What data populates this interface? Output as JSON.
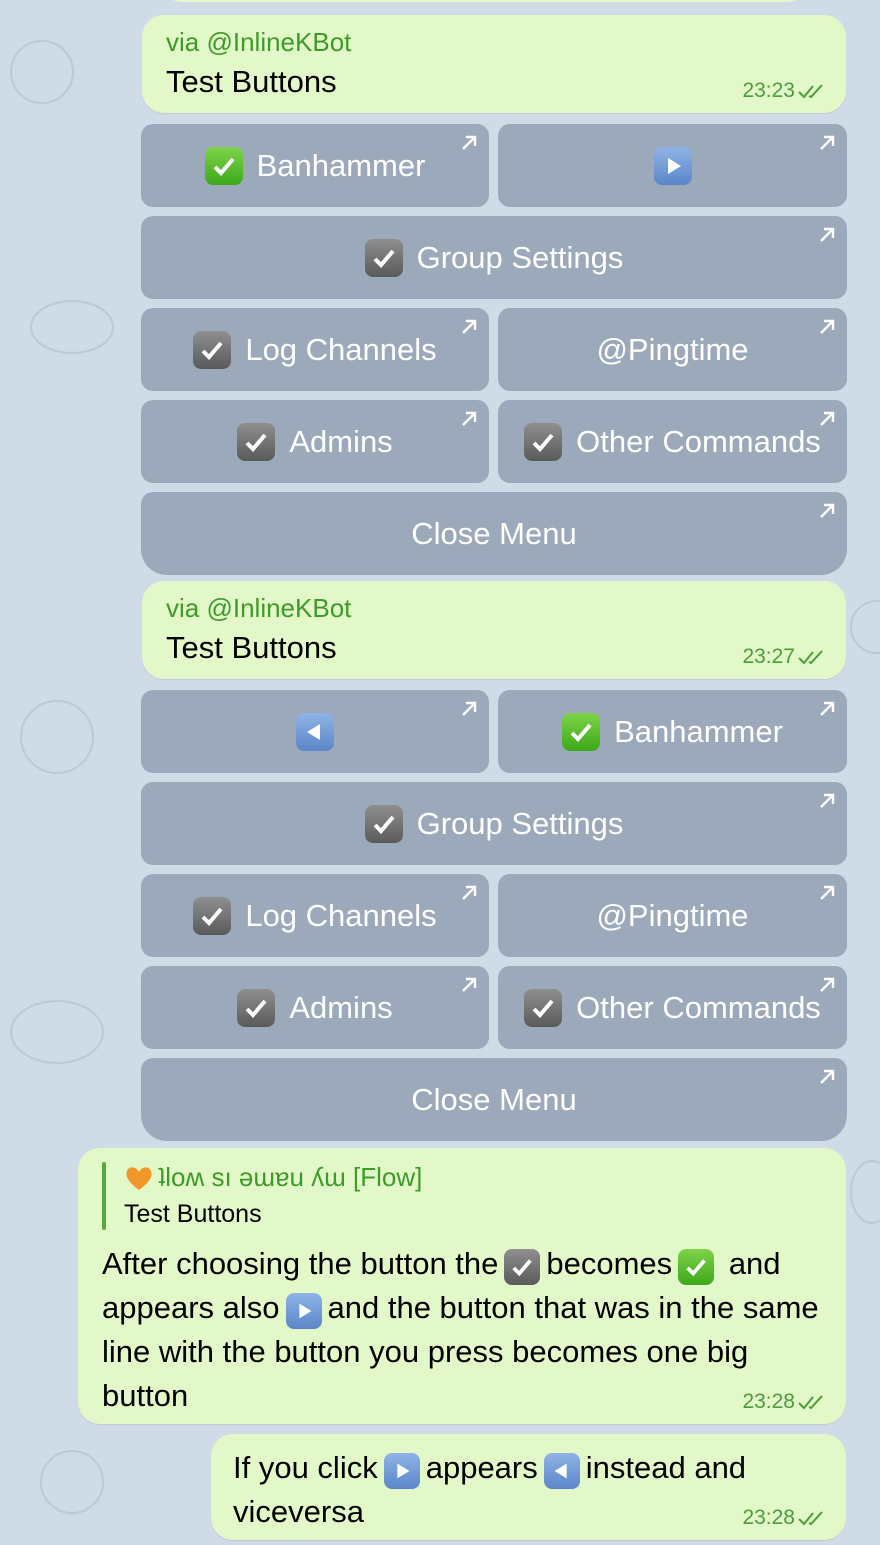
{
  "messages": [
    {
      "via": "via @InlineKBot",
      "title": "Test Buttons",
      "time": "23:23",
      "keyboard": {
        "banhammer": "Banhammer",
        "group_settings": "Group Settings",
        "log_channels": "Log Channels",
        "pingtime": "@Pingtime",
        "admins": "Admins",
        "other_commands": "Other Commands",
        "close_menu": "Close Menu"
      }
    },
    {
      "via": "via @InlineKBot",
      "title": "Test Buttons",
      "time": "23:27",
      "keyboard": {
        "banhammer": "Banhammer",
        "group_settings": "Group Settings",
        "log_channels": "Log Channels",
        "pingtime": "@Pingtime",
        "admins": "Admins",
        "other_commands": "Other Commands",
        "close_menu": "Close Menu"
      }
    }
  ],
  "reply_message": {
    "reply_author": "ʇloʍ sı ǝɯɐu ʎɯ [Flow]",
    "reply_text": "Test Buttons",
    "text_part1": "After choosing the button the",
    "text_part2": "becomes",
    "text_part3": "and appears also",
    "text_part4": "and the button that was in the same line with the button you press becomes one big button",
    "time": "23:28"
  },
  "last_message": {
    "text_part1": "If you click",
    "text_part2": "appears",
    "text_part3": "instead and viceversa",
    "time": "23:28"
  },
  "icons": {
    "check_gray": "ballot-box-with-check-icon",
    "check_green": "white-check-mark-icon",
    "play": "play-button-icon",
    "reverse": "reverse-button-icon",
    "heart": "orange-heart-icon",
    "arrow": "inline-button-arrow-icon"
  },
  "colors": {
    "outgoing_bubble": "#e3f8c8",
    "accent_green": "#3e9b2a",
    "button_bg": "#8796aa",
    "background": "#cfdbe6"
  }
}
